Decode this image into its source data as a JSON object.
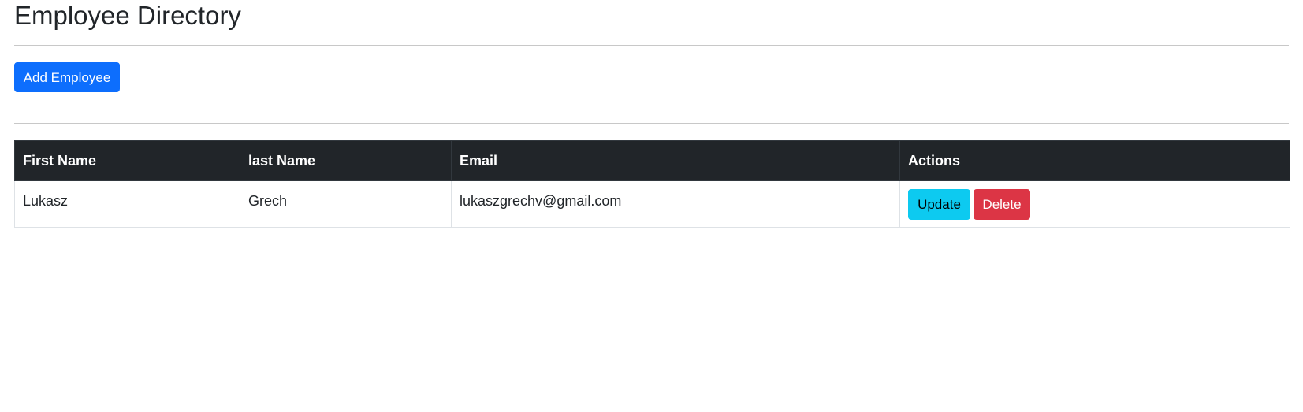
{
  "page": {
    "title": "Employee Directory"
  },
  "toolbar": {
    "add_label": "Add Employee"
  },
  "table": {
    "headers": [
      "First Name",
      "last Name",
      "Email",
      "Actions"
    ],
    "rows": [
      {
        "first_name": "Lukasz",
        "last_name": "Grech",
        "email": "lukaszgrechv@gmail.com",
        "update_label": "Update",
        "delete_label": "Delete"
      }
    ]
  },
  "colors": {
    "primary": "#0d6efd",
    "info": "#0dcaf0",
    "danger": "#dc3545",
    "table_header_bg": "#212529"
  }
}
